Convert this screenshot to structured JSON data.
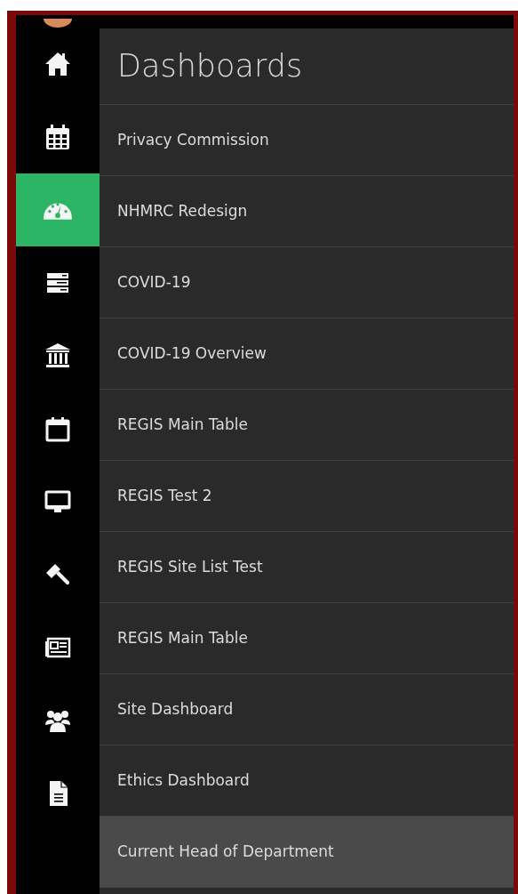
{
  "sidebar": {
    "items": [
      {
        "selected": false
      },
      {
        "selected": false
      },
      {
        "selected": true
      },
      {
        "selected": false
      },
      {
        "selected": false
      },
      {
        "selected": false
      },
      {
        "selected": false
      },
      {
        "selected": false
      },
      {
        "selected": false
      },
      {
        "selected": false
      },
      {
        "selected": false
      }
    ]
  },
  "menu": {
    "title": "Dashboards",
    "items": [
      {
        "label": "Privacy Commission",
        "selected": false
      },
      {
        "label": "NHMRC Redesign",
        "selected": false
      },
      {
        "label": "COVID-19",
        "selected": false
      },
      {
        "label": "COVID-19 Overview",
        "selected": false
      },
      {
        "label": "REGIS Main Table",
        "selected": false
      },
      {
        "label": "REGIS Test 2",
        "selected": false
      },
      {
        "label": "REGIS Site List Test",
        "selected": false
      },
      {
        "label": "REGIS Main Table",
        "selected": false
      },
      {
        "label": "Site Dashboard",
        "selected": false
      },
      {
        "label": "Ethics Dashboard",
        "selected": false
      },
      {
        "label": "Current Head of Department",
        "selected": true
      }
    ]
  }
}
